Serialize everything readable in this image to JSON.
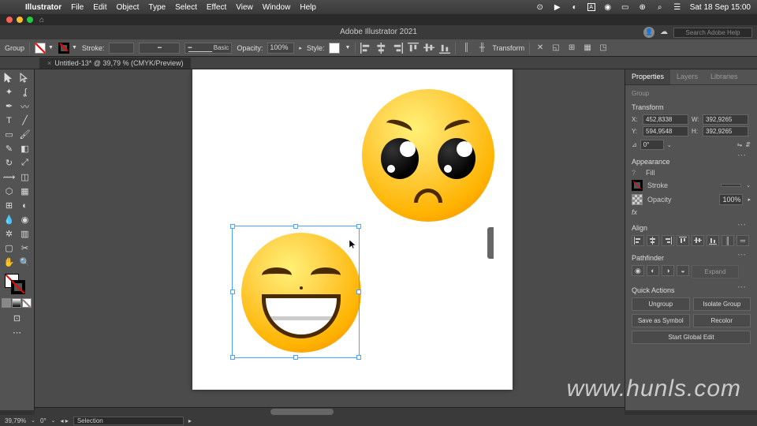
{
  "menubar": {
    "app": "Illustrator",
    "items": [
      "File",
      "Edit",
      "Object",
      "Type",
      "Select",
      "Effect",
      "View",
      "Window",
      "Help"
    ],
    "datetime": "Sat 18 Sep  15:00"
  },
  "window": {
    "title": "Adobe Illustrator 2021",
    "search_ph": "Search Adobe Help"
  },
  "tab": {
    "name": "Untitled-13* @ 39,79 % (CMYK/Preview)"
  },
  "controlbar": {
    "sel": "Group",
    "stroke_label": "Stroke:",
    "basic": "Basic",
    "opacity_label": "Opacity:",
    "opacity_val": "100%",
    "style_label": "Style:",
    "transform": "Transform"
  },
  "props": {
    "tabs": [
      "Properties",
      "Layers",
      "Libraries"
    ],
    "group": "Group",
    "transform": {
      "title": "Transform",
      "x": "452,8338",
      "y": "594,9548",
      "w": "392,9265",
      "h": "392,9265",
      "angle": "0°"
    },
    "appearance": {
      "title": "Appearance",
      "fill": "Fill",
      "stroke": "Stroke",
      "opacity": "Opacity",
      "opacity_val": "100%",
      "fx": "fx"
    },
    "align": {
      "title": "Align"
    },
    "pathfinder": {
      "title": "Pathfinder",
      "expand": "Expand"
    },
    "quick": {
      "title": "Quick Actions",
      "ungroup": "Ungroup",
      "isolate": "Isolate Group",
      "save": "Save as Symbol",
      "recolor": "Recolor",
      "global": "Start Global Edit"
    }
  },
  "status": {
    "zoom": "39,79%",
    "angle": "0°",
    "mode": "Selection"
  },
  "watermark": "www.hunls.com"
}
